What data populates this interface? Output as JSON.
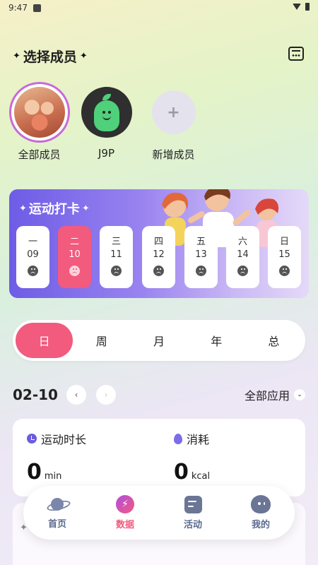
{
  "status_bar": {
    "time": "9:47"
  },
  "members_section": {
    "title": "选择成员"
  },
  "members": [
    {
      "label": "全部成员"
    },
    {
      "label": "J9P"
    },
    {
      "label": "新增成员",
      "add_symbol": "+"
    }
  ],
  "checkin": {
    "title": "运动打卡",
    "days": [
      {
        "weekday": "一",
        "date": "09"
      },
      {
        "weekday": "二",
        "date": "10"
      },
      {
        "weekday": "三",
        "date": "11"
      },
      {
        "weekday": "四",
        "date": "12"
      },
      {
        "weekday": "五",
        "date": "13"
      },
      {
        "weekday": "六",
        "date": "14"
      },
      {
        "weekday": "日",
        "date": "15"
      }
    ]
  },
  "period_tabs": [
    "日",
    "周",
    "月",
    "年",
    "总"
  ],
  "date_nav": {
    "date": "02-10",
    "prev": "‹",
    "next": "›",
    "filter_label": "全部应用",
    "filter_chevron": "⌄"
  },
  "stats": {
    "duration": {
      "label": "运动时长",
      "value": "0",
      "unit": "min"
    },
    "calories": {
      "label": "消耗",
      "value": "0",
      "unit": "kcal"
    }
  },
  "bottom_nav": [
    {
      "label": "首页",
      "icon": "planet-icon"
    },
    {
      "label": "数据",
      "icon": "bolt-icon"
    },
    {
      "label": "活动",
      "icon": "activity-icon"
    },
    {
      "label": "我的",
      "icon": "mine-icon"
    }
  ],
  "colors": {
    "accent": "#f25a7e",
    "banner": "#6d5ce6",
    "nav_inactive": "#5a6a8e"
  }
}
